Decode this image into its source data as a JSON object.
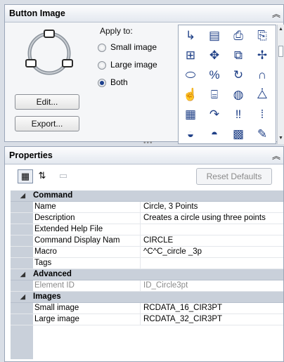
{
  "button_image": {
    "title": "Button Image",
    "apply_to_label": "Apply to:",
    "options": [
      "Small image",
      "Large image",
      "Both"
    ],
    "selected_index": 2,
    "edit_label": "Edit...",
    "export_label": "Export...",
    "icons": [
      "polyline-icon",
      "layer-stack-icon",
      "printer-preview-icon",
      "paste-icon",
      "multi-shape-icon",
      "move-icon",
      "copy-icon",
      "move-cross-icon",
      "offset-icon",
      "percent-icon",
      "rotate-icon",
      "magnet-icon",
      "hand-pan-icon",
      "text-block-icon",
      "globe-icon",
      "triangle-icon",
      "table-icon",
      "rotate-arrow-icon",
      "footprints-icon",
      "steps-icon",
      "lightbulb-icon",
      "shapes-icon",
      "grid-icon",
      "pencil-icon"
    ],
    "icon_glyphs": [
      "↳",
      "▤",
      "⎙",
      "⎘",
      "⊞",
      "✥",
      "⧉",
      "✢",
      "⬭",
      "%",
      "↻",
      "∩",
      "☝",
      "⌸",
      "◍",
      "⧊",
      "▦",
      "↷",
      "‼",
      "⁞",
      "◒",
      "◓",
      "▩",
      "✎"
    ]
  },
  "properties": {
    "title": "Properties",
    "reset_label": "Reset Defaults",
    "categories": [
      {
        "label": "Command",
        "rows": [
          {
            "name": "Name",
            "value": "Circle, 3 Points"
          },
          {
            "name": "Description",
            "value": "Creates a circle using three points"
          },
          {
            "name": "Extended Help File",
            "value": ""
          },
          {
            "name": "Command Display Nam",
            "value": "CIRCLE"
          },
          {
            "name": "Macro",
            "value": "^C^C_circle _3p"
          },
          {
            "name": "Tags",
            "value": ""
          }
        ]
      },
      {
        "label": "Advanced",
        "rows": [
          {
            "name": "Element ID",
            "value": "ID_Circle3pt"
          }
        ]
      },
      {
        "label": "Images",
        "rows": [
          {
            "name": "Small image",
            "value": "RCDATA_16_CIR3PT"
          },
          {
            "name": "Large image",
            "value": "RCDATA_32_CIR3PT"
          }
        ]
      }
    ]
  }
}
